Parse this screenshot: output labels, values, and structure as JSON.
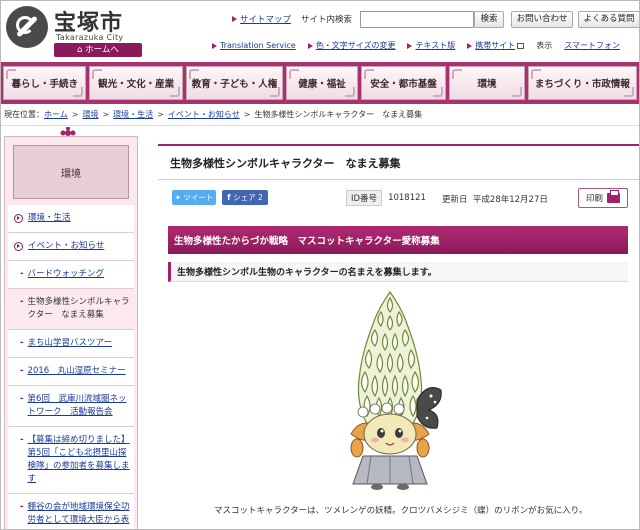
{
  "header": {
    "logo_name": "宝塚市",
    "logo_en": "Takarazuka City",
    "home_label": "ホームへ",
    "sitemap_label": "サイトマップ",
    "search_label": "サイト内検索",
    "search_placeholder": "",
    "search_button": "検索",
    "contact_button": "お問い合わせ",
    "faq_button": "よくある質問",
    "translation_label": "Translation Service",
    "color_text_label": "色・文字サイズの変更",
    "text_version_label": "テキスト版",
    "mobile_label": "携帯サイト",
    "display_label": "表示",
    "smartphone_label": "スマートフォン"
  },
  "nav": {
    "items": [
      "暮らし・手続き",
      "観光・文化・産業",
      "教育・子ども・人権",
      "健康・福祉",
      "安全・都市基盤",
      "環境",
      "まちづくり・市政情報"
    ]
  },
  "breadcrumb": {
    "prefix": "現在位置：",
    "items": [
      "ホーム",
      "環境",
      "環境・生活",
      "イベント・お知らせ"
    ],
    "current": "生物多様性シンボルキャラクター　なまえ募集"
  },
  "sidebar": {
    "heading": "環境",
    "items": [
      {
        "label": "環境・生活"
      },
      {
        "label": "イベント・お知らせ"
      },
      {
        "label": "バードウォッチング"
      },
      {
        "label": "生物多様性シンボルキャラクター　なまえ募集"
      },
      {
        "label": "まち山学習バスツアー"
      },
      {
        "label": "2016　丸山湿原セミナー"
      },
      {
        "label": "第6回　武庫川流域圏ネットワーク　活動報告会"
      },
      {
        "label": "【募集は締め切りました】第5回「こども北摂里山探検隊」の参加者を募集します"
      },
      {
        "label": "棚谷の会が地域環境保全功労者として環境大臣から表"
      }
    ]
  },
  "main": {
    "title": "生物多様性シンボルキャラクター　なまえ募集",
    "tweet_label": "ツイート",
    "share_label": "シェア",
    "share_count": "2",
    "id_label": "ID番号",
    "id_value": "1018121",
    "updated_label": "更新日",
    "updated_value": "平成28年12月27日",
    "print_label": "印刷",
    "heading2": "生物多様性たからづか戦略　マスコットキャラクター愛称募集",
    "heading3": "生物多様性シンボル生物のキャラクターの名まえを募集します。",
    "caption": "マスコットキャラクターは、ツメレンゲの妖精。クロツバメシジミ（蝶）のリボンがお気に入り。"
  },
  "colors": {
    "brand": "#a0236a",
    "nav_bg": "#a8326e",
    "sidebar_bg": "#fbe9ef",
    "link": "#1a3a9a"
  }
}
